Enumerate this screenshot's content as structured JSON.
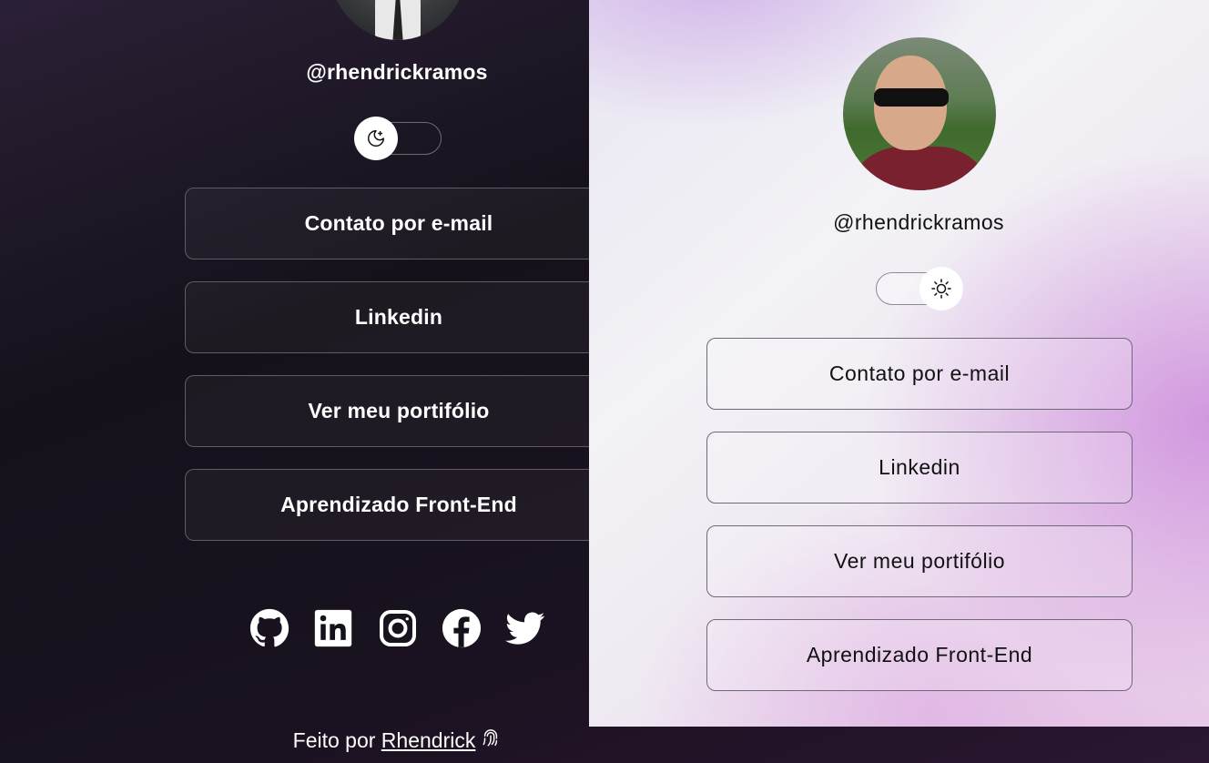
{
  "dark": {
    "handle": "@rhendrickramos",
    "theme_toggle_icon": "moon-stars-icon",
    "buttons": [
      {
        "label": "Contato por e-mail"
      },
      {
        "label": "Linkedin"
      },
      {
        "label": "Ver meu portifólio"
      },
      {
        "label": "Aprendizado Front-End"
      }
    ],
    "socials": [
      "github-icon",
      "linkedin-icon",
      "instagram-icon",
      "facebook-icon",
      "twitter-icon"
    ],
    "footer": {
      "prefix": "Feito por",
      "link": "Rhendrick",
      "icon": "fingerprint-icon"
    }
  },
  "light": {
    "handle": "@rhendrickramos",
    "theme_toggle_icon": "sun-icon",
    "buttons": [
      {
        "label": "Contato por e-mail"
      },
      {
        "label": "Linkedin"
      },
      {
        "label": "Ver meu portifólio"
      },
      {
        "label": "Aprendizado Front-End"
      }
    ]
  },
  "colors": {
    "dark_bg": "#15111a",
    "light_accent": "#cd8cdc",
    "text_dark": "#111111",
    "text_light": "#ffffff"
  }
}
